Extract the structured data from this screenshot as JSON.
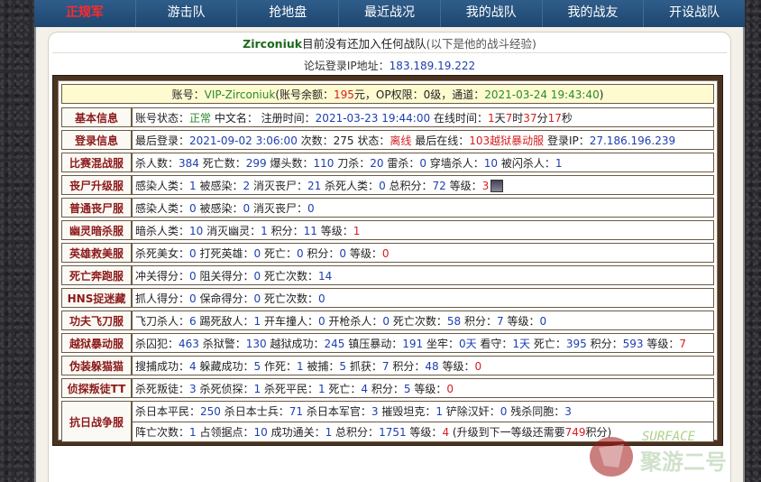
{
  "nav": {
    "items": [
      {
        "label": "正规军",
        "active": true
      },
      {
        "label": "游击队",
        "active": false
      },
      {
        "label": "抢地盘",
        "active": false
      },
      {
        "label": "最近战况",
        "active": false
      },
      {
        "label": "我的战队",
        "active": false
      },
      {
        "label": "我的战友",
        "active": false
      },
      {
        "label": "开设战队",
        "active": false
      }
    ]
  },
  "header": {
    "username": "Zirconiuk",
    "no_team_text": "目前没有还加入任何战队",
    "hint": "(以下是他的战斗经验)",
    "ip_label": "论坛登录IP地址：",
    "ip": "183.189.19.222"
  },
  "account": {
    "label_account": "账号：",
    "account": "VIP-Zirconiuk",
    "balance_label": "(账号余额：",
    "balance": "195",
    "balance_unit": "元，OP权限：0级，通道：",
    "channel_time": "2021-03-24 19:43:40",
    "close": ")"
  },
  "rows": {
    "basic": {
      "cat": "基本信息",
      "p1": "账号状态：",
      "status": "正常",
      "p2": " 中文名： 注册时间：",
      "reg": "2021-03-23 19:44:00",
      "p3": " 在线时间：",
      "d": "1",
      "p4": "天",
      "h": "7",
      "p5": "时",
      "m": "37",
      "p6": "分",
      "s": "17",
      "p7": "秒"
    },
    "login": {
      "cat": "登录信息",
      "p1": "最后登录：",
      "last": "2021-09-02 3:06:00",
      "p2": " 次数：275 状态：",
      "state": "离线",
      "p3": " 最后在线：",
      "server": "103越狱暴动服",
      "p4": " 登录IP：",
      "ip": "27.186.196.239"
    },
    "mix": {
      "cat": "比赛混战服",
      "p1": "杀人数：",
      "v1": "384",
      "p2": " 死亡数：",
      "v2": "299",
      "p3": " 爆头数：",
      "v3": "110",
      "p4": " 刀杀：",
      "v4": "20",
      "p5": " 雷杀：",
      "v5": "0",
      "p6": " 穿墙杀人：",
      "v6": "10",
      "p7": " 被闪杀人：",
      "v7": "1"
    },
    "zombie": {
      "cat": "丧尸升级服",
      "p1": "感染人类：",
      "v1": "1",
      "p2": " 被感染：",
      "v2": "2",
      "p3": " 消灭丧尸：",
      "v3": "21",
      "p4": " 杀死人类：",
      "v4": "0",
      "p5": " 总积分：",
      "v5": "72",
      "p6": " 等级：",
      "v6": "3"
    },
    "zombie_normal": {
      "cat": "普通丧尸服",
      "p1": "感染人类：",
      "v1": "0",
      "p2": " 被感染：",
      "v2": "0",
      "p3": " 消灭丧尸：",
      "v3": "0"
    },
    "ghost": {
      "cat": "幽灵暗杀服",
      "p1": "暗杀人类：",
      "v1": "10",
      "p2": " 消灭幽灵：",
      "v2": "1",
      "p3": " 积分：",
      "v3": "11",
      "p4": " 等级：",
      "v4": "1"
    },
    "hero": {
      "cat": "英雄救美服",
      "p1": "杀死美女：",
      "v1": "0",
      "p2": " 打死英雄：",
      "v2": "0",
      "p3": " 死亡：",
      "v3": "0",
      "p4": " 积分：",
      "v4": "0",
      "p5": " 等级：",
      "v5": "0"
    },
    "death_run": {
      "cat": "死亡奔跑服",
      "p1": "冲关得分：",
      "v1": "0",
      "p2": " 阻关得分：",
      "v2": "0",
      "p3": " 死亡次数：",
      "v3": "14"
    },
    "hns": {
      "cat": "HNS捉迷藏",
      "p1": "抓人得分：",
      "v1": "0",
      "p2": " 保命得分：",
      "v2": "0",
      "p3": " 死亡次数：",
      "v3": "0"
    },
    "kungfu": {
      "cat": "功夫飞刀服",
      "p1": "飞刀杀人：",
      "v1": "6",
      "p2": " 踢死敌人：",
      "v2": "1",
      "p3": " 开车撞人：",
      "v3": "0",
      "p4": " 开枪杀人：",
      "v4": "0",
      "p5": " 死亡次数：",
      "v5": "58",
      "p6": " 积分：",
      "v6": "7",
      "p7": " 等级：",
      "v7": "0"
    },
    "jail": {
      "cat": "越狱暴动服",
      "p1": "杀囚犯：",
      "v1": "463",
      "p2": " 杀狱警：",
      "v2": "130",
      "p3": " 越狱成功：",
      "v3": "245",
      "p4": " 镇压暴动：",
      "v4": "191",
      "p5": " 坐牢：",
      "v5": "0天",
      "p6": " 看守：",
      "v6": "1天",
      "p7": " 死亡：",
      "v7": "395",
      "p8": " 积分：",
      "v8": "593",
      "p9": " 等级：",
      "v9": "7"
    },
    "hide": {
      "cat": "伪装躲猫猫",
      "p1": "搜捕成功：",
      "v1": "4",
      "p2": " 躲藏成功：",
      "v2": "5",
      "p3": " 作死：",
      "v3": "1",
      "p4": " 被捕：",
      "v4": "5",
      "p5": " 抓获：",
      "v5": "7",
      "p6": " 积分：",
      "v6": "48",
      "p7": " 等级：",
      "v7": "0"
    },
    "traitor": {
      "cat": "侦探叛徒TT",
      "p1": "杀死叛徒：",
      "v1": "3",
      "p2": " 杀死侦探：",
      "v2": "1",
      "p3": " 杀死平民：",
      "v3": "1",
      "p4": " 死亡：",
      "v4": "4",
      "p5": " 积分：",
      "v5": "5",
      "p6": " 等级：",
      "v6": "0"
    },
    "war": {
      "cat": "抗日战争服",
      "a1": "杀日本平民：",
      "av1": "250",
      "a2": " 杀日本士兵：",
      "av2": "71",
      "a3": " 杀日本军官：",
      "av3": "3",
      "a4": " 摧毁坦克：",
      "av4": "1",
      "a5": " 铲除汉奸：",
      "av5": "0",
      "a6": " 残杀同胞：",
      "av6": "3",
      "b1": "阵亡次数：",
      "bv1": "1",
      "b2": " 占领据点：",
      "bv2": "10",
      "b3": " 成功通关：",
      "bv3": "1",
      "b4": " 总积分：",
      "bv4": "1751",
      "b5": " 等级：",
      "bv5": "4",
      "b6": " (升级到下一等级还需要",
      "bv6": "749",
      "b7": "积分)"
    }
  },
  "watermark": {
    "text_top": "SURFACE",
    "text_bottom": "聚游二号"
  }
}
